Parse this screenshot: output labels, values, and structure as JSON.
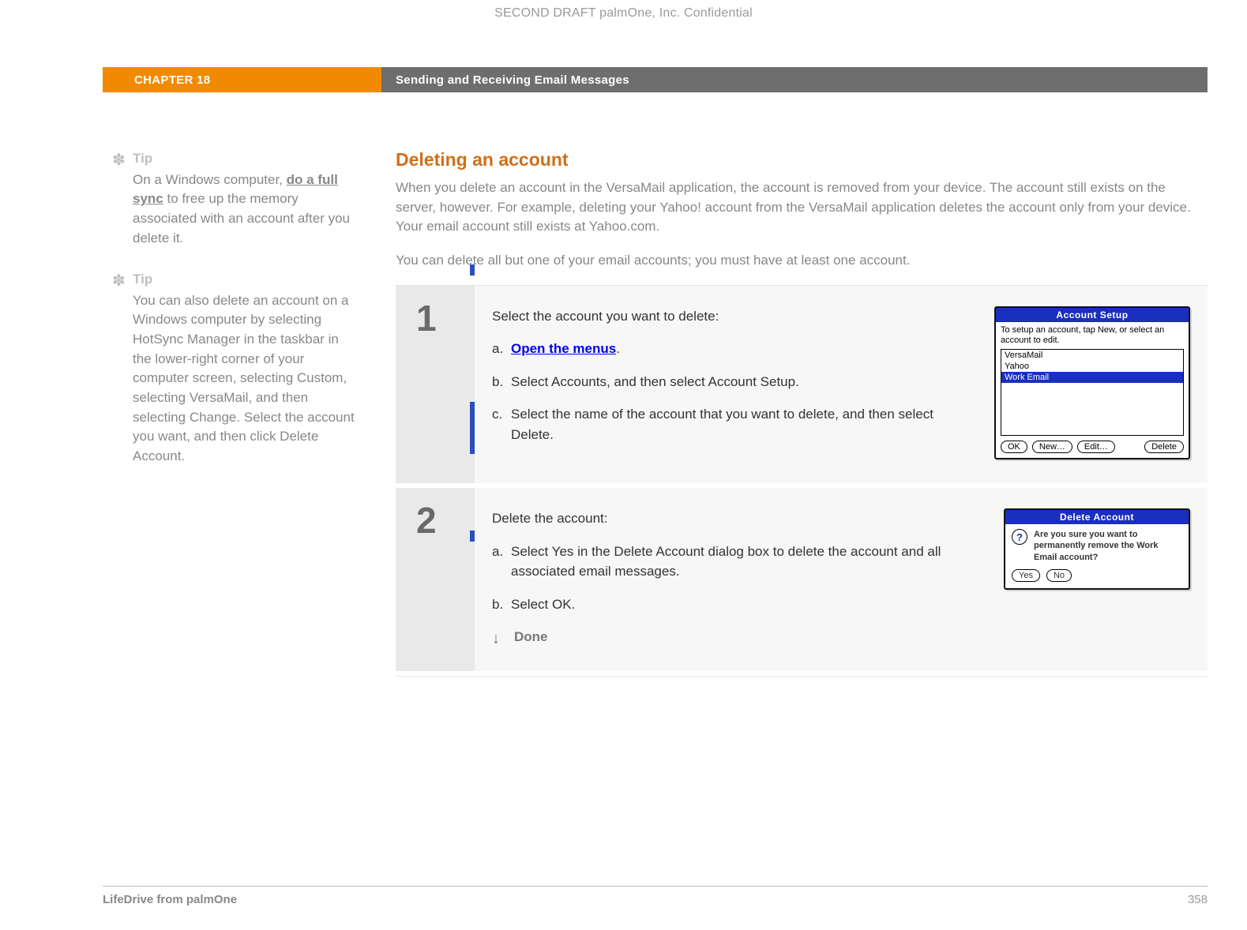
{
  "draft_header": "SECOND DRAFT palmOne, Inc.  Confidential",
  "chapter": {
    "label": "CHAPTER 18",
    "title": "Sending and Receiving Email Messages"
  },
  "sidebar": {
    "tip1": {
      "label": "Tip",
      "pre": "On a Windows computer, ",
      "link": "do a full sync",
      "post": " to free up the memory associated with an account after you delete it."
    },
    "tip2": {
      "label": "Tip",
      "body": "You can also delete an account on a Windows computer by selecting HotSync Manager in the taskbar in the lower-right corner of your computer screen, selecting Custom, selecting VersaMail, and then selecting Change. Select the account you want, and then click Delete Account."
    }
  },
  "main": {
    "heading": "Deleting an account",
    "intro1": "When you delete an account in the VersaMail application, the account is removed from your device. The account still exists on the server, however. For example, deleting your Yahoo! account from the VersaMail application deletes the account only from your device. Your email account still exists at Yahoo.com.",
    "intro2": "You can delete all but one of your email accounts; you must have at least one account."
  },
  "steps": {
    "s1": {
      "num": "1",
      "lead": "Select the account you want to delete:",
      "a_link": "Open the menus",
      "a_suffix": ".",
      "b": "Select Accounts, and then select Account Setup.",
      "c": "Select the name of the account that you want to delete, and then select Delete."
    },
    "s2": {
      "num": "2",
      "lead": "Delete the account:",
      "a": "Select Yes in the Delete Account dialog box to delete the account and all associated email messages.",
      "b": "Select OK.",
      "done": "Done"
    }
  },
  "palm_setup": {
    "title": "Account Setup",
    "hint": "To setup an account, tap New, or select an account to edit.",
    "items": [
      "VersaMail",
      "Yahoo",
      "Work Email"
    ],
    "btn_ok": "OK",
    "btn_new": "New…",
    "btn_edit": "Edit…",
    "btn_delete": "Delete"
  },
  "palm_delete": {
    "title": "Delete Account",
    "question": "Are you sure you want to permanently remove the Work Email account?",
    "btn_yes": "Yes",
    "btn_no": "No"
  },
  "footer": {
    "product": "LifeDrive from palmOne",
    "page": "358"
  }
}
